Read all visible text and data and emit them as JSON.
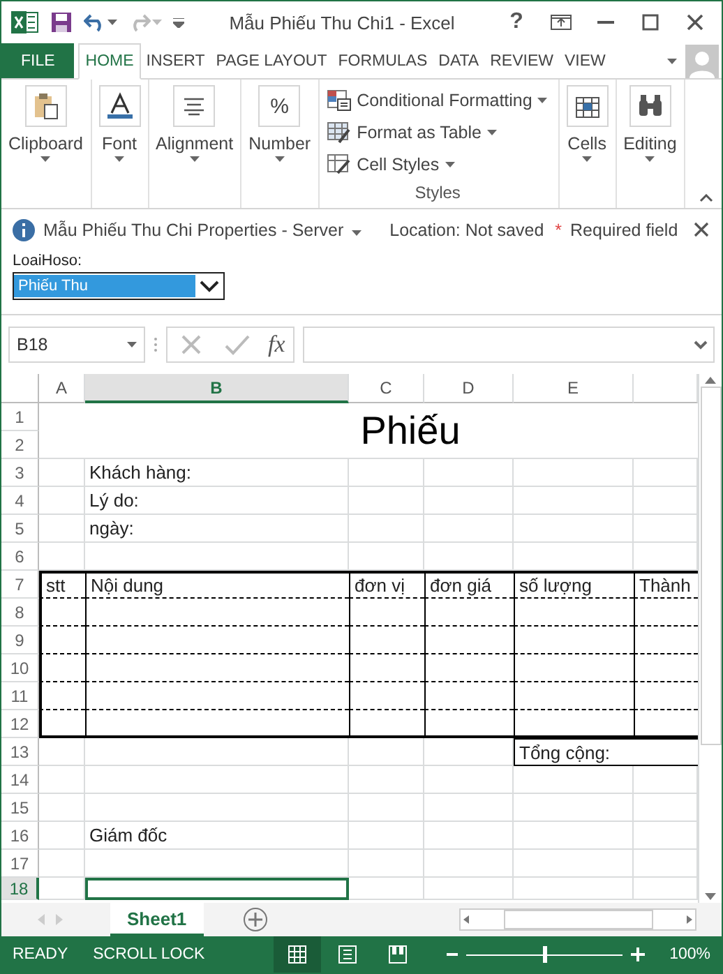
{
  "window": {
    "title": "Mẫu Phiếu Thu Chi1 - Excel",
    "help": "?"
  },
  "ribbon_tabs": [
    {
      "label": "FILE",
      "kind": "file",
      "selected": false
    },
    {
      "label": "HOME",
      "kind": "tab",
      "selected": true
    },
    {
      "label": "INSERT",
      "kind": "tab",
      "selected": false
    },
    {
      "label": "PAGE LAYOUT",
      "kind": "tab",
      "selected": false
    },
    {
      "label": "FORMULAS",
      "kind": "tab",
      "selected": false
    },
    {
      "label": "DATA",
      "kind": "tab",
      "selected": false
    },
    {
      "label": "REVIEW",
      "kind": "tab",
      "selected": false
    },
    {
      "label": "VIEW",
      "kind": "tab",
      "selected": false
    }
  ],
  "ribbon_groups": [
    {
      "label": "Clipboard",
      "kind": "clipboard"
    },
    {
      "label": "Font",
      "kind": "font"
    },
    {
      "label": "Alignment",
      "kind": "alignment"
    },
    {
      "label": "Number",
      "kind": "number",
      "symbol": "%"
    },
    {
      "label": "Styles",
      "kind": "styles",
      "items": [
        {
          "label": "Conditional Formatting",
          "kind": "conditional"
        },
        {
          "label": "Format as Table",
          "kind": "table"
        },
        {
          "label": "Cell Styles",
          "kind": "cellstyles"
        }
      ]
    },
    {
      "label": "Cells",
      "kind": "cells"
    },
    {
      "label": "Editing",
      "kind": "editing"
    }
  ],
  "info_bar": {
    "document": "Mẫu Phiếu Thu Chi Properties - Server",
    "location": "Location: Not saved",
    "required_mark": "*",
    "required": "Required field"
  },
  "property_field": {
    "label": "LoaiHoso:",
    "value": "Phiếu Thu",
    "selected": true
  },
  "formula_bar": {
    "name_box": "B18",
    "function_label": "fx"
  },
  "sheet": {
    "title": "Phiếu",
    "columns": [
      {
        "label": "A",
        "selected": false
      },
      {
        "label": "B",
        "selected": true
      },
      {
        "label": "C",
        "selected": false
      },
      {
        "label": "D",
        "selected": false
      },
      {
        "label": "E",
        "selected": false
      }
    ],
    "rows": [
      {
        "number": "1",
        "kind": "title",
        "selected": false
      },
      {
        "number": "2",
        "kind": "title",
        "selected": false
      },
      {
        "number": "3",
        "kind": "plain",
        "selected": false,
        "B": "Khách hàng:"
      },
      {
        "number": "4",
        "kind": "plain",
        "selected": false,
        "B": "Lý do:"
      },
      {
        "number": "5",
        "kind": "plain",
        "selected": false,
        "B": "ngày:"
      },
      {
        "number": "6",
        "kind": "plain",
        "selected": false
      },
      {
        "number": "7",
        "kind": "table_header",
        "selected": false,
        "A": "stt",
        "B": "Nội dung",
        "C": "đơn vị",
        "D": "đơn giá",
        "E": "số lượng",
        "F": "Thành"
      },
      {
        "number": "8",
        "kind": "table_body",
        "selected": false
      },
      {
        "number": "9",
        "kind": "table_body",
        "selected": false
      },
      {
        "number": "10",
        "kind": "table_body",
        "selected": false
      },
      {
        "number": "11",
        "kind": "table_body",
        "selected": false
      },
      {
        "number": "12",
        "kind": "table_body",
        "selected": false
      },
      {
        "number": "13",
        "kind": "total",
        "selected": false,
        "E": "Tổng cộng:"
      },
      {
        "number": "14",
        "kind": "plain",
        "selected": false
      },
      {
        "number": "15",
        "kind": "plain",
        "selected": false
      },
      {
        "number": "16",
        "kind": "plain",
        "selected": false,
        "B": "Giám đốc"
      },
      {
        "number": "17",
        "kind": "plain",
        "selected": false
      },
      {
        "number": "18",
        "kind": "plain",
        "selected": true
      }
    ]
  },
  "sheet_tabs": [
    {
      "label": "Sheet1",
      "selected": true
    }
  ],
  "status_bar": {
    "mode": "READY",
    "scroll_lock": "SCROLL LOCK",
    "views": [
      {
        "kind": "normal",
        "selected": true
      },
      {
        "kind": "page_layout",
        "selected": false
      },
      {
        "kind": "page_break",
        "selected": false
      }
    ],
    "zoom": {
      "level": 0.5,
      "reading": "100%"
    }
  }
}
